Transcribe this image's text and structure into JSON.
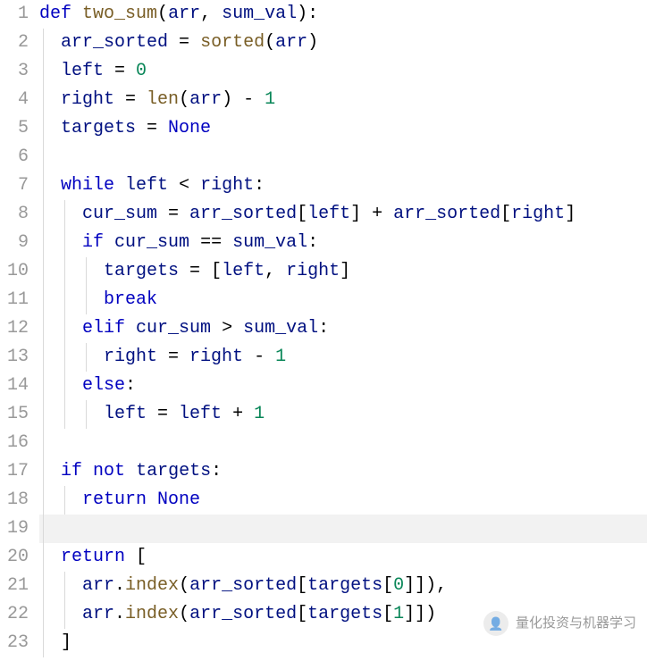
{
  "editor": {
    "highlighted_line": 19,
    "lines": [
      {
        "n": 1,
        "guides": [],
        "tokens": [
          [
            "kw",
            "def"
          ],
          [
            "punct",
            " "
          ],
          [
            "fn",
            "two_sum"
          ],
          [
            "punct",
            "("
          ],
          [
            "id",
            "arr"
          ],
          [
            "punct",
            ", "
          ],
          [
            "id",
            "sum_val"
          ],
          [
            "punct",
            "):"
          ]
        ]
      },
      {
        "n": 2,
        "guides": [
          0
        ],
        "tokens": [
          [
            "punct",
            "  "
          ],
          [
            "id",
            "arr_sorted"
          ],
          [
            "op",
            " = "
          ],
          [
            "bi",
            "sorted"
          ],
          [
            "punct",
            "("
          ],
          [
            "id",
            "arr"
          ],
          [
            "punct",
            ")"
          ]
        ]
      },
      {
        "n": 3,
        "guides": [
          0
        ],
        "tokens": [
          [
            "punct",
            "  "
          ],
          [
            "id",
            "left"
          ],
          [
            "op",
            " = "
          ],
          [
            "num",
            "0"
          ]
        ]
      },
      {
        "n": 4,
        "guides": [
          0
        ],
        "tokens": [
          [
            "punct",
            "  "
          ],
          [
            "id",
            "right"
          ],
          [
            "op",
            " = "
          ],
          [
            "bi",
            "len"
          ],
          [
            "punct",
            "("
          ],
          [
            "id",
            "arr"
          ],
          [
            "punct",
            ") - "
          ],
          [
            "num",
            "1"
          ]
        ]
      },
      {
        "n": 5,
        "guides": [
          0
        ],
        "tokens": [
          [
            "punct",
            "  "
          ],
          [
            "id",
            "targets"
          ],
          [
            "op",
            " = "
          ],
          [
            "const",
            "None"
          ]
        ]
      },
      {
        "n": 6,
        "guides": [
          0
        ],
        "tokens": []
      },
      {
        "n": 7,
        "guides": [
          0
        ],
        "tokens": [
          [
            "punct",
            "  "
          ],
          [
            "kw",
            "while"
          ],
          [
            "punct",
            " "
          ],
          [
            "id",
            "left"
          ],
          [
            "op",
            " < "
          ],
          [
            "id",
            "right"
          ],
          [
            "punct",
            ":"
          ]
        ]
      },
      {
        "n": 8,
        "guides": [
          0,
          1
        ],
        "tokens": [
          [
            "punct",
            "    "
          ],
          [
            "id",
            "cur_sum"
          ],
          [
            "op",
            " = "
          ],
          [
            "id",
            "arr_sorted"
          ],
          [
            "punct",
            "["
          ],
          [
            "id",
            "left"
          ],
          [
            "punct",
            "] + "
          ],
          [
            "id",
            "arr_sorted"
          ],
          [
            "punct",
            "["
          ],
          [
            "id",
            "right"
          ],
          [
            "punct",
            "]"
          ]
        ]
      },
      {
        "n": 9,
        "guides": [
          0,
          1
        ],
        "tokens": [
          [
            "punct",
            "    "
          ],
          [
            "kw",
            "if"
          ],
          [
            "punct",
            " "
          ],
          [
            "id",
            "cur_sum"
          ],
          [
            "op",
            " == "
          ],
          [
            "id",
            "sum_val"
          ],
          [
            "punct",
            ":"
          ]
        ]
      },
      {
        "n": 10,
        "guides": [
          0,
          1,
          2
        ],
        "tokens": [
          [
            "punct",
            "      "
          ],
          [
            "id",
            "targets"
          ],
          [
            "op",
            " = "
          ],
          [
            "punct",
            "["
          ],
          [
            "id",
            "left"
          ],
          [
            "punct",
            ", "
          ],
          [
            "id",
            "right"
          ],
          [
            "punct",
            "]"
          ]
        ]
      },
      {
        "n": 11,
        "guides": [
          0,
          1,
          2
        ],
        "tokens": [
          [
            "punct",
            "      "
          ],
          [
            "kw",
            "break"
          ]
        ]
      },
      {
        "n": 12,
        "guides": [
          0,
          1
        ],
        "tokens": [
          [
            "punct",
            "    "
          ],
          [
            "kw",
            "elif"
          ],
          [
            "punct",
            " "
          ],
          [
            "id",
            "cur_sum"
          ],
          [
            "op",
            " > "
          ],
          [
            "id",
            "sum_val"
          ],
          [
            "punct",
            ":"
          ]
        ]
      },
      {
        "n": 13,
        "guides": [
          0,
          1,
          2
        ],
        "tokens": [
          [
            "punct",
            "      "
          ],
          [
            "id",
            "right"
          ],
          [
            "op",
            " = "
          ],
          [
            "id",
            "right"
          ],
          [
            "op",
            " - "
          ],
          [
            "num",
            "1"
          ]
        ]
      },
      {
        "n": 14,
        "guides": [
          0,
          1
        ],
        "tokens": [
          [
            "punct",
            "    "
          ],
          [
            "kw",
            "else"
          ],
          [
            "punct",
            ":"
          ]
        ]
      },
      {
        "n": 15,
        "guides": [
          0,
          1,
          2
        ],
        "tokens": [
          [
            "punct",
            "      "
          ],
          [
            "id",
            "left"
          ],
          [
            "op",
            " = "
          ],
          [
            "id",
            "left"
          ],
          [
            "op",
            " + "
          ],
          [
            "num",
            "1"
          ]
        ]
      },
      {
        "n": 16,
        "guides": [
          0
        ],
        "tokens": []
      },
      {
        "n": 17,
        "guides": [
          0
        ],
        "tokens": [
          [
            "punct",
            "  "
          ],
          [
            "kw",
            "if"
          ],
          [
            "punct",
            " "
          ],
          [
            "kw",
            "not"
          ],
          [
            "punct",
            " "
          ],
          [
            "id",
            "targets"
          ],
          [
            "punct",
            ":"
          ]
        ]
      },
      {
        "n": 18,
        "guides": [
          0,
          1
        ],
        "tokens": [
          [
            "punct",
            "    "
          ],
          [
            "kw",
            "return"
          ],
          [
            "punct",
            " "
          ],
          [
            "const",
            "None"
          ]
        ]
      },
      {
        "n": 19,
        "guides": [
          0
        ],
        "tokens": []
      },
      {
        "n": 20,
        "guides": [
          0
        ],
        "tokens": [
          [
            "punct",
            "  "
          ],
          [
            "kw",
            "return"
          ],
          [
            "punct",
            " ["
          ]
        ]
      },
      {
        "n": 21,
        "guides": [
          0,
          1
        ],
        "tokens": [
          [
            "punct",
            "    "
          ],
          [
            "id",
            "arr"
          ],
          [
            "punct",
            "."
          ],
          [
            "fn",
            "index"
          ],
          [
            "punct",
            "("
          ],
          [
            "id",
            "arr_sorted"
          ],
          [
            "punct",
            "["
          ],
          [
            "id",
            "targets"
          ],
          [
            "punct",
            "["
          ],
          [
            "num",
            "0"
          ],
          [
            "punct",
            "]]),"
          ]
        ]
      },
      {
        "n": 22,
        "guides": [
          0,
          1
        ],
        "tokens": [
          [
            "punct",
            "    "
          ],
          [
            "id",
            "arr"
          ],
          [
            "punct",
            "."
          ],
          [
            "fn",
            "index"
          ],
          [
            "punct",
            "("
          ],
          [
            "id",
            "arr_sorted"
          ],
          [
            "punct",
            "["
          ],
          [
            "id",
            "targets"
          ],
          [
            "punct",
            "["
          ],
          [
            "num",
            "1"
          ],
          [
            "punct",
            "]])"
          ]
        ]
      },
      {
        "n": 23,
        "guides": [
          0
        ],
        "tokens": [
          [
            "punct",
            "  ]"
          ]
        ]
      }
    ]
  },
  "watermark": {
    "icon_label": "👤",
    "text": "量化投资与机器学习"
  }
}
